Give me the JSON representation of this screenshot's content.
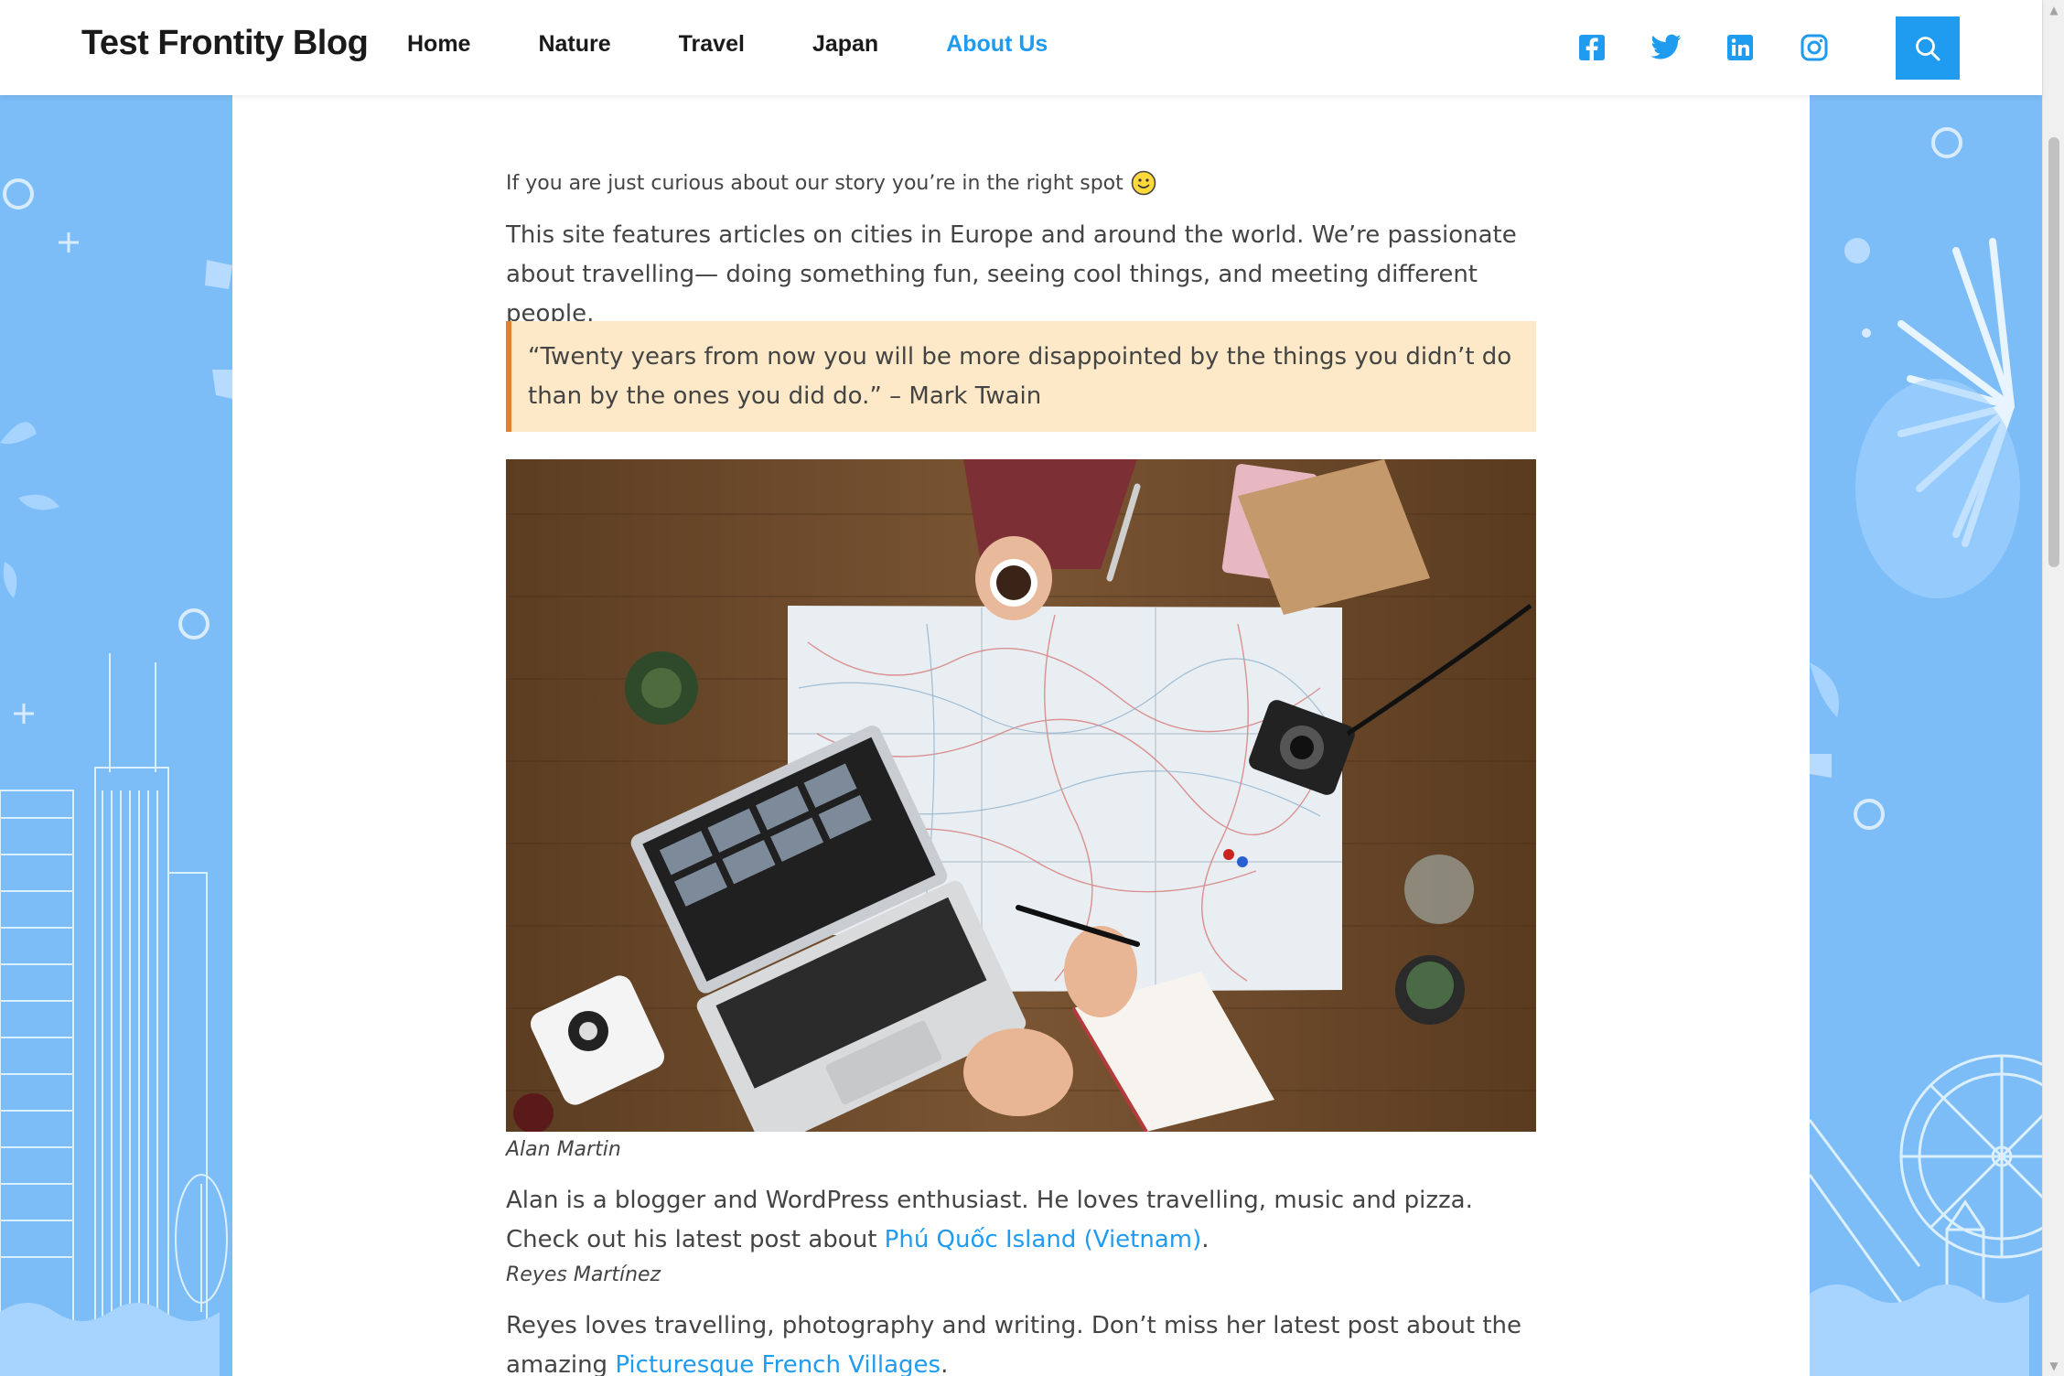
{
  "header": {
    "site_title": "Test Frontity Blog",
    "nav": [
      "Home",
      "Nature",
      "Travel",
      "Japan",
      "About Us"
    ],
    "active_nav": "About Us",
    "social_icons": [
      "facebook-icon",
      "twitter-icon",
      "linkedin-icon",
      "instagram-icon"
    ],
    "search_icon": "search-icon"
  },
  "colors": {
    "accent": "#1f9bf0",
    "background": "#7cbdf7",
    "quote_bg": "#fde9c7",
    "quote_border": "#e3802f"
  },
  "article": {
    "intro": "If you are just curious about our story you’re in the right spot",
    "p1": "This site features articles on cities in Europe and around the world. We’re passionate about travelling— doing something fun, seeing cool things, and meeting different people.",
    "quote": "“Twenty years from now you will be more disappointed by the things you didn’t do than by the ones you did do.” – Mark Twain",
    "image_icon": "travel-planning-photo",
    "caption1": "Alan Martin",
    "p2_text": "Alan is a blogger and WordPress enthusiast. He loves travelling, music and pizza. Check out his latest post about ",
    "p2_link": "Phú Quốc Island (Vietnam)",
    "p2_end": ".",
    "caption2": "Reyes Martínez",
    "p3_text": "Reyes loves travelling, photography and writing. Don’t miss her latest post about the amazing ",
    "p3_link": "Picturesque French Villages",
    "p3_end": "."
  }
}
